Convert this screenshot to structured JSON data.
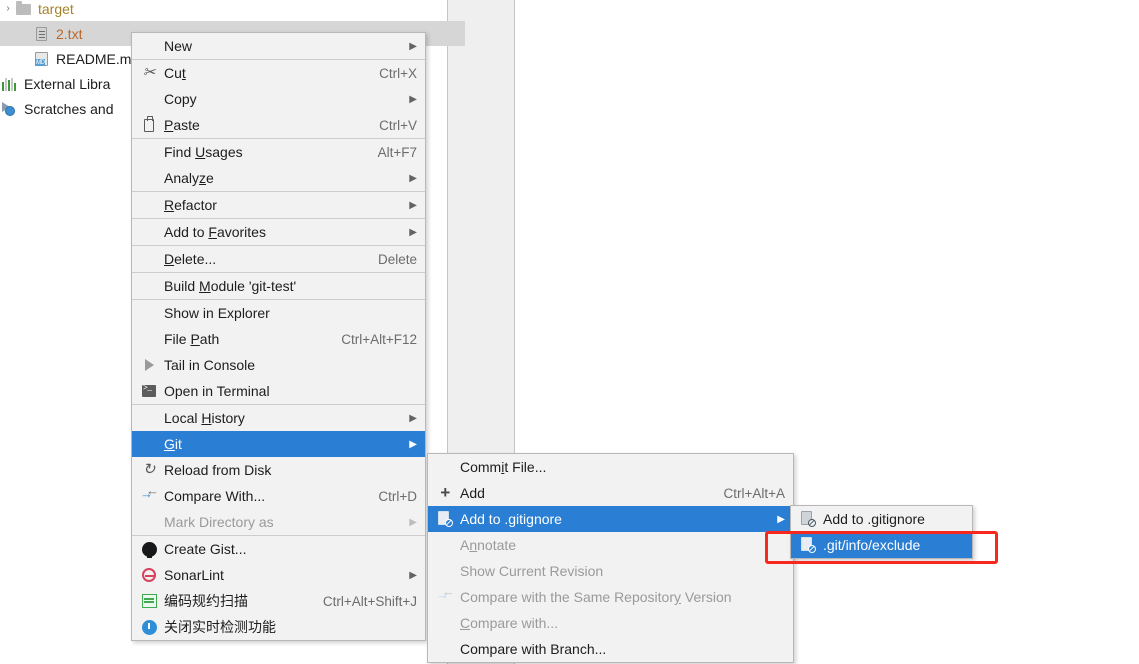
{
  "tree": {
    "items": [
      {
        "label": "target",
        "icon": "folder-icon",
        "indent": 18,
        "arrow": "›",
        "selected": false,
        "color": "dir-orange"
      },
      {
        "label": "2.txt",
        "icon": "text-file-icon",
        "indent": 36,
        "arrow": "",
        "selected": true,
        "color": "file-orange"
      },
      {
        "label": "README.m",
        "icon": "markdown-file-icon",
        "indent": 36,
        "arrow": "",
        "selected": false,
        "color": ""
      },
      {
        "label": "External Libra",
        "icon": "external-libraries-icon",
        "indent": 2,
        "arrow": "",
        "selected": false,
        "color": ""
      },
      {
        "label": "Scratches and",
        "icon": "scratches-icon",
        "indent": 2,
        "arrow": "",
        "selected": false,
        "color": ""
      }
    ]
  },
  "context_menu": {
    "name": "file-context-menu",
    "items": [
      {
        "type": "item",
        "name": "new",
        "label": "New",
        "accel": "",
        "arrow": true,
        "icon": "",
        "state": "normal",
        "mnemonic": ""
      },
      {
        "type": "separator"
      },
      {
        "type": "item",
        "name": "cut",
        "label": "Cut",
        "accel": "Ctrl+X",
        "arrow": false,
        "icon": "scissors-icon",
        "state": "normal",
        "mnemonic": "t"
      },
      {
        "type": "item",
        "name": "copy",
        "label": "Copy",
        "accel": "",
        "arrow": true,
        "icon": "",
        "state": "normal",
        "mnemonic": ""
      },
      {
        "type": "item",
        "name": "paste",
        "label": "Paste",
        "accel": "Ctrl+V",
        "arrow": false,
        "icon": "clipboard-icon",
        "state": "normal",
        "mnemonic": "P"
      },
      {
        "type": "separator"
      },
      {
        "type": "item",
        "name": "find-usages",
        "label": "Find Usages",
        "accel": "Alt+F7",
        "arrow": false,
        "icon": "",
        "state": "normal",
        "mnemonic": "U"
      },
      {
        "type": "item",
        "name": "analyze",
        "label": "Analyze",
        "accel": "",
        "arrow": true,
        "icon": "",
        "state": "normal",
        "mnemonic": "z"
      },
      {
        "type": "separator"
      },
      {
        "type": "item",
        "name": "refactor",
        "label": "Refactor",
        "accel": "",
        "arrow": true,
        "icon": "",
        "state": "normal",
        "mnemonic": "R"
      },
      {
        "type": "separator"
      },
      {
        "type": "item",
        "name": "add-to-favorites",
        "label": "Add to Favorites",
        "accel": "",
        "arrow": true,
        "icon": "",
        "state": "normal",
        "mnemonic": "F"
      },
      {
        "type": "separator"
      },
      {
        "type": "item",
        "name": "delete",
        "label": "Delete...",
        "accel": "Delete",
        "arrow": false,
        "icon": "",
        "state": "normal",
        "mnemonic": "D"
      },
      {
        "type": "separator"
      },
      {
        "type": "item",
        "name": "build-module",
        "label": "Build Module 'git-test'",
        "accel": "",
        "arrow": false,
        "icon": "",
        "state": "normal",
        "mnemonic": "M"
      },
      {
        "type": "separator"
      },
      {
        "type": "item",
        "name": "show-in-explorer",
        "label": "Show in Explorer",
        "accel": "",
        "arrow": false,
        "icon": "",
        "state": "normal",
        "mnemonic": ""
      },
      {
        "type": "item",
        "name": "file-path",
        "label": "File Path",
        "accel": "Ctrl+Alt+F12",
        "arrow": false,
        "icon": "",
        "state": "normal",
        "mnemonic": "P"
      },
      {
        "type": "item",
        "name": "tail-in-console",
        "label": "Tail in Console",
        "accel": "",
        "arrow": false,
        "icon": "play-icon",
        "state": "normal",
        "mnemonic": ""
      },
      {
        "type": "item",
        "name": "open-in-terminal",
        "label": "Open in Terminal",
        "accel": "",
        "arrow": false,
        "icon": "terminal-icon",
        "state": "normal",
        "mnemonic": ""
      },
      {
        "type": "separator"
      },
      {
        "type": "item",
        "name": "local-history",
        "label": "Local History",
        "accel": "",
        "arrow": true,
        "icon": "",
        "state": "normal",
        "mnemonic": "H"
      },
      {
        "type": "item",
        "name": "git",
        "label": "Git",
        "accel": "",
        "arrow": true,
        "icon": "",
        "state": "selected",
        "mnemonic": "G"
      },
      {
        "type": "item",
        "name": "reload-from-disk",
        "label": "Reload from Disk",
        "accel": "",
        "arrow": false,
        "icon": "reload-icon",
        "state": "normal",
        "mnemonic": ""
      },
      {
        "type": "item",
        "name": "compare-with",
        "label": "Compare With...",
        "accel": "Ctrl+D",
        "arrow": false,
        "icon": "compare-icon",
        "state": "normal",
        "mnemonic": ""
      },
      {
        "type": "item",
        "name": "mark-directory-as",
        "label": "Mark Directory as",
        "accel": "",
        "arrow": true,
        "icon": "",
        "state": "disabled",
        "mnemonic": ""
      },
      {
        "type": "separator"
      },
      {
        "type": "item",
        "name": "create-gist",
        "label": "Create Gist...",
        "accel": "",
        "arrow": false,
        "icon": "github-icon",
        "state": "normal",
        "mnemonic": ""
      },
      {
        "type": "item",
        "name": "sonarlint",
        "label": "SonarLint",
        "accel": "",
        "arrow": true,
        "icon": "sonarlint-icon",
        "state": "normal",
        "mnemonic": ""
      },
      {
        "type": "item",
        "name": "code-convention-scan",
        "label": "编码规约扫描",
        "accel": "Ctrl+Alt+Shift+J",
        "arrow": false,
        "icon": "waveform-icon",
        "state": "normal",
        "mnemonic": ""
      },
      {
        "type": "item",
        "name": "disable-realtime-detection",
        "label": "关闭实时检测功能",
        "accel": "",
        "arrow": false,
        "icon": "blue-circle-icon",
        "state": "normal",
        "mnemonic": ""
      }
    ]
  },
  "git_submenu": {
    "name": "git-submenu",
    "items": [
      {
        "type": "item",
        "name": "commit-file",
        "label": "Commit File...",
        "accel": "",
        "arrow": false,
        "icon": "",
        "state": "normal",
        "mnemonic": "i"
      },
      {
        "type": "item",
        "name": "add",
        "label": "Add",
        "accel": "Ctrl+Alt+A",
        "arrow": false,
        "icon": "plus-icon",
        "state": "normal",
        "mnemonic": ""
      },
      {
        "type": "item",
        "name": "add-to-gitignore",
        "label": "Add to .gitignore",
        "accel": "",
        "arrow": true,
        "icon": "gitignore-icon",
        "state": "selected",
        "mnemonic": ""
      },
      {
        "type": "item",
        "name": "annotate",
        "label": "Annotate",
        "accel": "",
        "arrow": false,
        "icon": "",
        "state": "disabled",
        "mnemonic": "n"
      },
      {
        "type": "item",
        "name": "show-current-revision",
        "label": "Show Current Revision",
        "accel": "",
        "arrow": false,
        "icon": "",
        "state": "disabled",
        "mnemonic": ""
      },
      {
        "type": "item",
        "name": "compare-same-repo-version",
        "label": "Compare with the Same Repository Version",
        "accel": "",
        "arrow": false,
        "icon": "compare-icon-dim",
        "state": "disabled",
        "mnemonic": "y"
      },
      {
        "type": "item",
        "name": "compare-with-dots",
        "label": "Compare with...",
        "accel": "",
        "arrow": false,
        "icon": "",
        "state": "disabled",
        "mnemonic": "C"
      },
      {
        "type": "item",
        "name": "compare-with-branch",
        "label": "Compare with Branch...",
        "accel": "",
        "arrow": false,
        "icon": "",
        "state": "normal",
        "mnemonic": ""
      }
    ]
  },
  "gitignore_submenu": {
    "name": "gitignore-submenu",
    "items": [
      {
        "type": "item",
        "name": "add-to-gitignore-file",
        "label": "Add to .gitignore",
        "accel": "",
        "arrow": false,
        "icon": "gitignore-icon",
        "state": "normal",
        "mnemonic": ""
      },
      {
        "type": "item",
        "name": "git-info-exclude",
        "label": ".git/info/exclude",
        "accel": "",
        "arrow": false,
        "icon": "gitignore-icon",
        "state": "selected",
        "mnemonic": ""
      }
    ]
  },
  "annotation": {
    "name": "red-highlight-box",
    "color": "#f8281e",
    "target": ".git/info/exclude"
  }
}
